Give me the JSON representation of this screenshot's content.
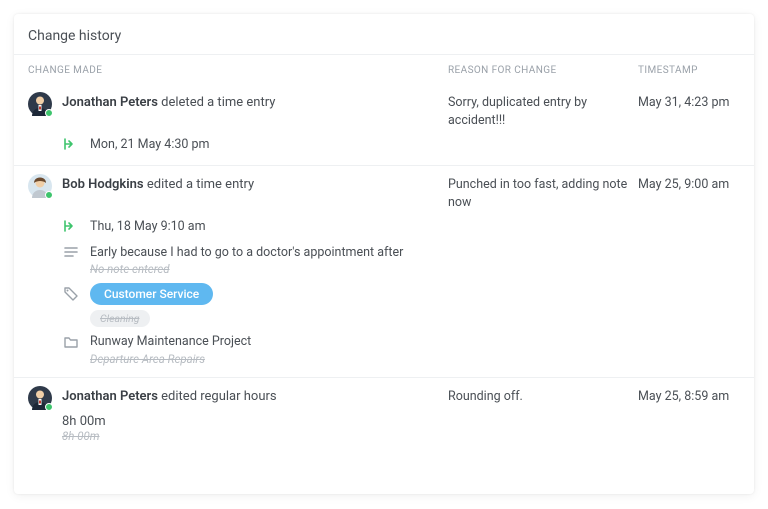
{
  "panel": {
    "title": "Change history",
    "columns": {
      "change_made": "CHANGE MADE",
      "reason": "REASON FOR CHANGE",
      "timestamp": "TIMESTAMP"
    }
  },
  "entries": [
    {
      "user": "Jonathan Peters",
      "avatar": "suit",
      "action": "deleted a time entry",
      "reason": "Sorry, duplicated entry by accident!!!",
      "timestamp": "May 31, 4:23 pm",
      "details": [
        {
          "type": "time-in",
          "text": "Mon, 21 May 4:30 pm"
        }
      ]
    },
    {
      "user": "Bob Hodgkins",
      "avatar": "casual",
      "action": "edited a time entry",
      "reason": "Punched in too fast, adding note now",
      "timestamp": "May 25, 9:00 am",
      "details": [
        {
          "type": "time-in",
          "text": "Thu, 18 May 9:10 am"
        },
        {
          "type": "note",
          "text": "Early because I had to go to a doctor's appointment after",
          "ghost": "No note entered"
        },
        {
          "type": "tag",
          "text": "Customer Service",
          "ghost": "Cleaning"
        },
        {
          "type": "project",
          "text": "Runway Maintenance Project",
          "ghost": "Departure Area Repairs"
        }
      ]
    },
    {
      "user": "Jonathan Peters",
      "avatar": "suit",
      "action": "edited regular hours",
      "reason": "Rounding off.",
      "timestamp": "May 25, 8:59 am",
      "value": "8h 00m",
      "ghost": "8h 00m"
    }
  ]
}
